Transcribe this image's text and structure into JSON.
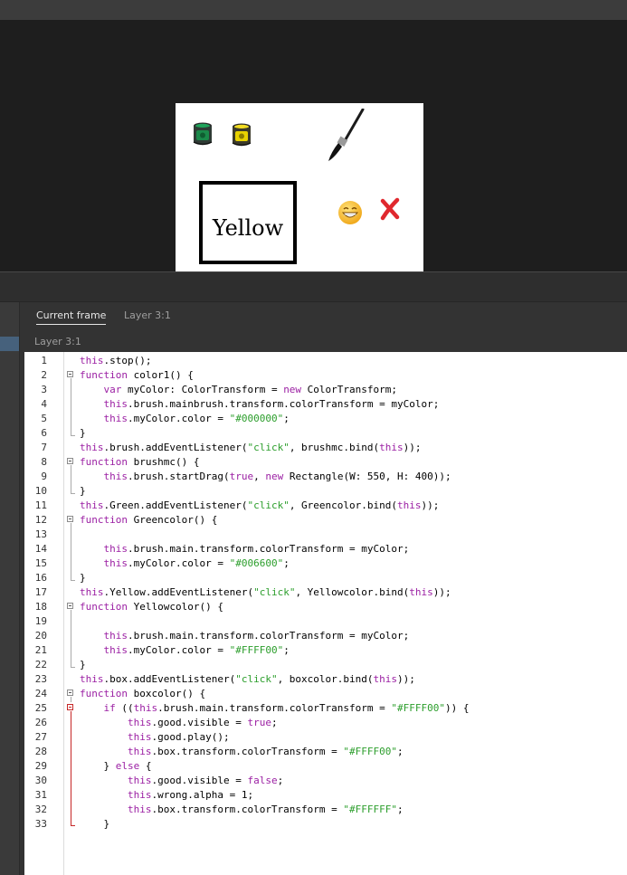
{
  "stage": {
    "box_label": "Yellow",
    "paint_cans": [
      {
        "name": "green-paint-can-icon",
        "color": "#1a8a4a"
      },
      {
        "name": "yellow-paint-can-icon",
        "color": "#e8d200"
      }
    ],
    "brush_icon": "paintbrush-icon",
    "smiley_icon": "grinning-face-icon",
    "wrong_icon": "red-x-icon",
    "accent_red": "#e0282e",
    "accent_yellow": "#f5c12b"
  },
  "actions_panel": {
    "tabs": [
      {
        "label": "Current frame",
        "active": true
      },
      {
        "label": "Layer 3:1",
        "active": false
      }
    ],
    "layer_label": "Layer 3:1"
  },
  "code": {
    "line_numbers": [
      "1",
      "2",
      "3",
      "4",
      "5",
      "6",
      "7",
      "8",
      "9",
      "10",
      "11",
      "12",
      "13",
      "14",
      "15",
      "16",
      "17",
      "18",
      "19",
      "20",
      "21",
      "22",
      "23",
      "24",
      "25",
      "26",
      "27",
      "28",
      "29",
      "30",
      "31",
      "32",
      "33"
    ],
    "lines": [
      [
        {
          "t": "this",
          "c": "kw"
        },
        {
          "t": ".stop();"
        }
      ],
      [
        {
          "t": "function",
          "c": "kw"
        },
        {
          "t": " color1() {"
        }
      ],
      [
        {
          "t": "    "
        },
        {
          "t": "var",
          "c": "kw"
        },
        {
          "t": " myColor: ColorTransform = "
        },
        {
          "t": "new",
          "c": "kw"
        },
        {
          "t": " ColorTransform;"
        }
      ],
      [
        {
          "t": "    "
        },
        {
          "t": "this",
          "c": "kw"
        },
        {
          "t": ".brush.mainbrush.transform.colorTransform = myColor;"
        }
      ],
      [
        {
          "t": "    "
        },
        {
          "t": "this",
          "c": "kw"
        },
        {
          "t": ".myColor.color = "
        },
        {
          "t": "\"#000000\"",
          "c": "str"
        },
        {
          "t": ";"
        }
      ],
      [
        {
          "t": "}"
        }
      ],
      [
        {
          "t": "this",
          "c": "kw"
        },
        {
          "t": ".brush.addEventListener("
        },
        {
          "t": "\"click\"",
          "c": "str"
        },
        {
          "t": ", brushmc.bind("
        },
        {
          "t": "this",
          "c": "kw"
        },
        {
          "t": "));"
        }
      ],
      [
        {
          "t": "function",
          "c": "kw"
        },
        {
          "t": " brushmc() {"
        }
      ],
      [
        {
          "t": "    "
        },
        {
          "t": "this",
          "c": "kw"
        },
        {
          "t": ".brush.startDrag("
        },
        {
          "t": "true",
          "c": "kw"
        },
        {
          "t": ", "
        },
        {
          "t": "new",
          "c": "kw"
        },
        {
          "t": " Rectangle(W: 550, H: 400));"
        }
      ],
      [
        {
          "t": "}"
        }
      ],
      [
        {
          "t": "this",
          "c": "kw"
        },
        {
          "t": ".Green.addEventListener("
        },
        {
          "t": "\"click\"",
          "c": "str"
        },
        {
          "t": ", Greencolor.bind("
        },
        {
          "t": "this",
          "c": "kw"
        },
        {
          "t": "));"
        }
      ],
      [
        {
          "t": "function",
          "c": "kw"
        },
        {
          "t": " Greencolor() {"
        }
      ],
      [],
      [
        {
          "t": "    "
        },
        {
          "t": "this",
          "c": "kw"
        },
        {
          "t": ".brush.main.transform.colorTransform = myColor;"
        }
      ],
      [
        {
          "t": "    "
        },
        {
          "t": "this",
          "c": "kw"
        },
        {
          "t": ".myColor.color = "
        },
        {
          "t": "\"#006600\"",
          "c": "str"
        },
        {
          "t": ";"
        }
      ],
      [
        {
          "t": "}"
        }
      ],
      [
        {
          "t": "this",
          "c": "kw"
        },
        {
          "t": ".Yellow.addEventListener("
        },
        {
          "t": "\"click\"",
          "c": "str"
        },
        {
          "t": ", Yellowcolor.bind("
        },
        {
          "t": "this",
          "c": "kw"
        },
        {
          "t": "));"
        }
      ],
      [
        {
          "t": "function",
          "c": "kw"
        },
        {
          "t": " Yellowcolor() {"
        }
      ],
      [],
      [
        {
          "t": "    "
        },
        {
          "t": "this",
          "c": "kw"
        },
        {
          "t": ".brush.main.transform.colorTransform = myColor;"
        }
      ],
      [
        {
          "t": "    "
        },
        {
          "t": "this",
          "c": "kw"
        },
        {
          "t": ".myColor.color = "
        },
        {
          "t": "\"#FFFF00\"",
          "c": "str"
        },
        {
          "t": ";"
        }
      ],
      [
        {
          "t": "}"
        }
      ],
      [
        {
          "t": "this",
          "c": "kw"
        },
        {
          "t": ".box.addEventListener("
        },
        {
          "t": "\"click\"",
          "c": "str"
        },
        {
          "t": ", boxcolor.bind("
        },
        {
          "t": "this",
          "c": "kw"
        },
        {
          "t": "));"
        }
      ],
      [
        {
          "t": "function",
          "c": "kw"
        },
        {
          "t": " boxcolor() {"
        }
      ],
      [
        {
          "t": "    "
        },
        {
          "t": "if",
          "c": "kw"
        },
        {
          "t": " (("
        },
        {
          "t": "this",
          "c": "kw"
        },
        {
          "t": ".brush.main.transform.colorTransform = "
        },
        {
          "t": "\"#FFFF00\"",
          "c": "str"
        },
        {
          "t": ")) {"
        }
      ],
      [
        {
          "t": "        "
        },
        {
          "t": "this",
          "c": "kw"
        },
        {
          "t": ".good.visible = "
        },
        {
          "t": "true",
          "c": "kw"
        },
        {
          "t": ";"
        }
      ],
      [
        {
          "t": "        "
        },
        {
          "t": "this",
          "c": "kw"
        },
        {
          "t": ".good.play();"
        }
      ],
      [
        {
          "t": "        "
        },
        {
          "t": "this",
          "c": "kw"
        },
        {
          "t": ".box.transform.colorTransform = "
        },
        {
          "t": "\"#FFFF00\"",
          "c": "str"
        },
        {
          "t": ";"
        }
      ],
      [
        {
          "t": "    } "
        },
        {
          "t": "else",
          "c": "kw"
        },
        {
          "t": " {"
        }
      ],
      [
        {
          "t": "        "
        },
        {
          "t": "this",
          "c": "kw"
        },
        {
          "t": ".good.visible = "
        },
        {
          "t": "false",
          "c": "kw"
        },
        {
          "t": ";"
        }
      ],
      [
        {
          "t": "        "
        },
        {
          "t": "this",
          "c": "kw"
        },
        {
          "t": ".wrong.alpha = 1;"
        }
      ],
      [
        {
          "t": "        "
        },
        {
          "t": "this",
          "c": "kw"
        },
        {
          "t": ".box.transform.colorTransform = "
        },
        {
          "t": "\"#FFFFFF\"",
          "c": "str"
        },
        {
          "t": ";"
        }
      ],
      [
        {
          "t": "    }"
        }
      ]
    ]
  }
}
